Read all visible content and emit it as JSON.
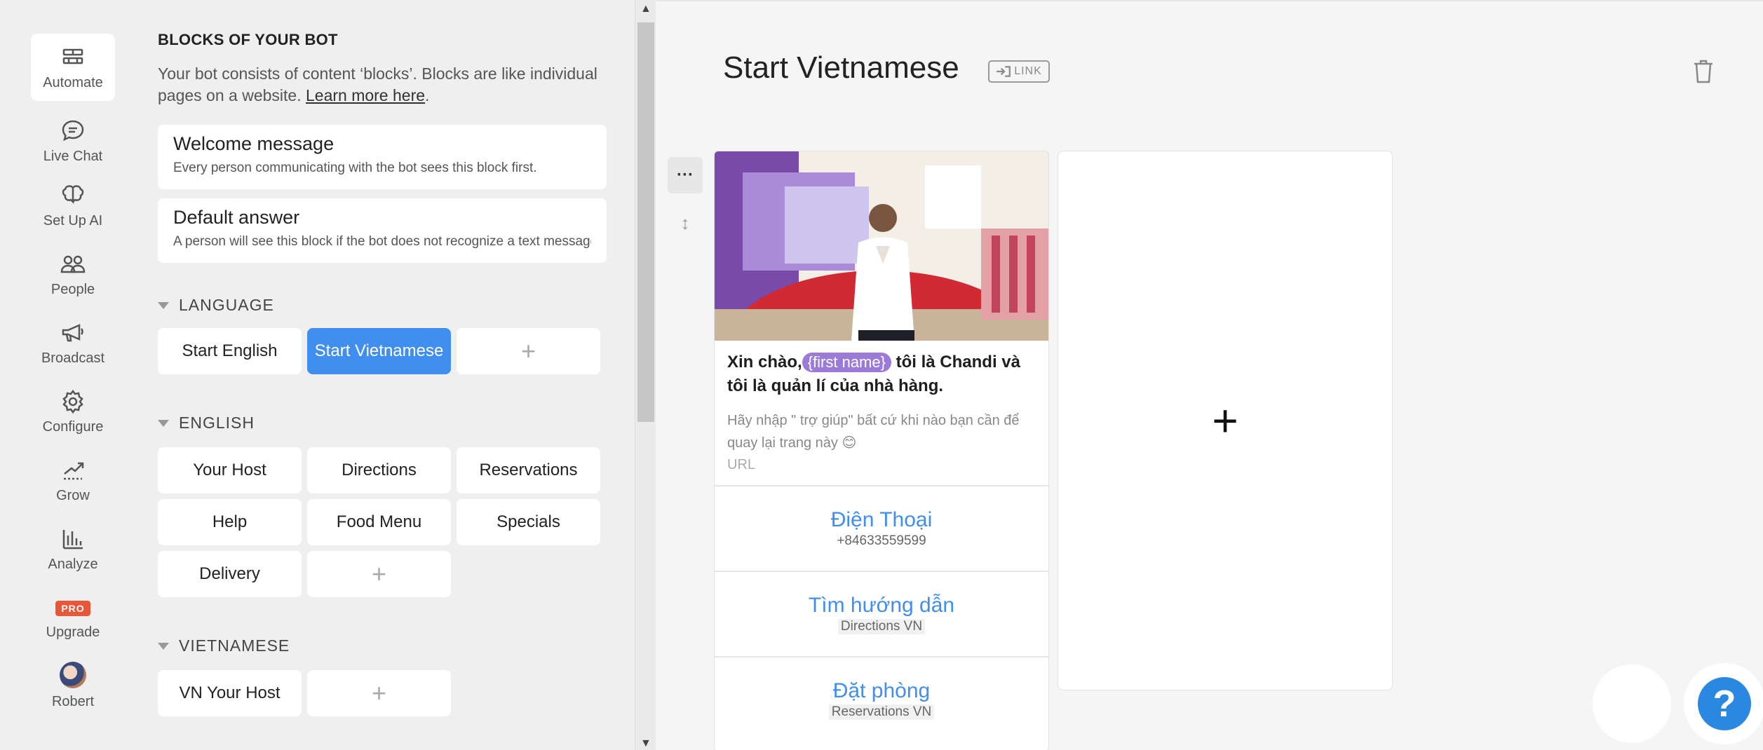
{
  "nav": [
    {
      "label": "Automate",
      "icon": "bricks-icon",
      "active": true
    },
    {
      "label": "Live Chat",
      "icon": "chat-icon"
    },
    {
      "label": "Set Up AI",
      "icon": "brain-icon"
    },
    {
      "label": "People",
      "icon": "people-icon"
    },
    {
      "label": "Broadcast",
      "icon": "megaphone-icon"
    },
    {
      "label": "Configure",
      "icon": "gear-icon"
    },
    {
      "label": "Grow",
      "icon": "grow-icon"
    },
    {
      "label": "Analyze",
      "icon": "bar-chart-icon"
    },
    {
      "label": "Upgrade",
      "badge": "PRO"
    },
    {
      "label": "Robert",
      "icon": "avatar"
    }
  ],
  "blocks": {
    "title": "BLOCKS OF YOUR BOT",
    "description": "Your bot consists of content ‘blocks’. Blocks are like individual pages on a website.",
    "learn_more": "Learn more here",
    "description_end": ".",
    "welcome": {
      "title": "Welcome message",
      "desc": "Every person communicating with the bot sees this block first."
    },
    "default": {
      "title": "Default answer",
      "desc": "A person will see this block if the bot does not recognize a text message."
    },
    "groups": [
      {
        "name": "LANGUAGE",
        "items": [
          "Start English",
          "Start Vietnamese"
        ]
      },
      {
        "name": "ENGLISH",
        "items": [
          "Your Host",
          "Directions",
          "Reservations",
          "Help",
          "Food Menu",
          "Specials",
          "Delivery"
        ]
      },
      {
        "name": "VIETNAMESE",
        "items": [
          "VN Your Host"
        ]
      }
    ],
    "add_symbol": "+"
  },
  "editor": {
    "block_title": "Start Vietnamese",
    "link_label": "LINK",
    "card": {
      "title_before": "Xin chào,",
      "attribute": "{first name}",
      "title_after": " tôi là Chandi và tôi là quản lí của nhà hàng.",
      "subtitle": "Hãy nhập \" trợ giúp\" bất cứ khi nào bạn cần để quay lại trang này 😊",
      "url": "URL",
      "buttons": [
        {
          "title": "Điện Thoại",
          "sub": "+84633559599"
        },
        {
          "title": "Tìm hướng dẫn",
          "sub": "Directions VN"
        },
        {
          "title": "Đặt phòng",
          "sub": "Reservations VN"
        }
      ]
    },
    "add_card_symbol": "+",
    "help_symbol": "?"
  },
  "colors": {
    "accent": "#3f8ef0",
    "pro_badge": "#e8573a",
    "attribute": "#9b7ad8",
    "help": "#2a88e0"
  }
}
